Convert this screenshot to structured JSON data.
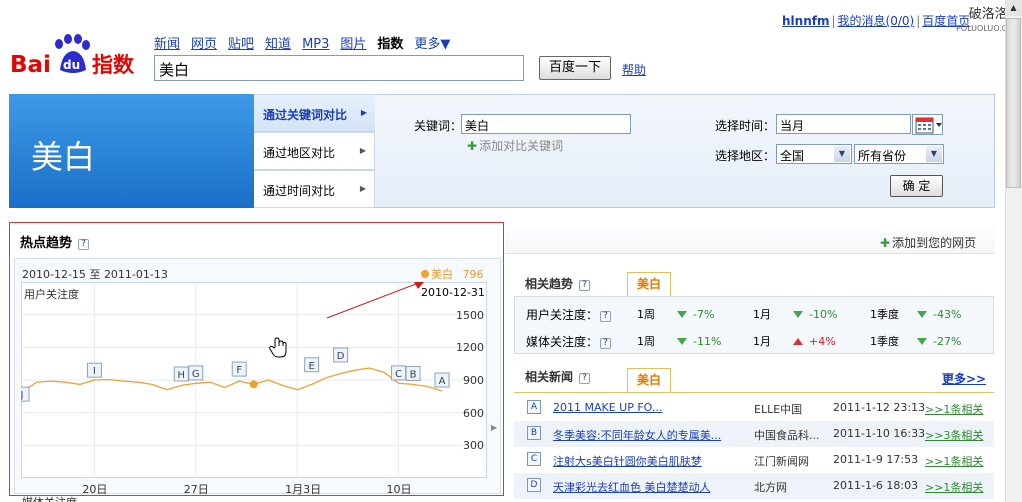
{
  "top_bar": {
    "username": "hlnnfm",
    "messages": "我的消息(0/0)",
    "baidu_home": "百度首页",
    "watermark": "破洛洛",
    "watermark_sub": "POLUOLUO.COM"
  },
  "logo": {
    "text_left": "Bai",
    "text_du": "du",
    "text_right": "指数",
    "brand_red": "#e10602",
    "brand_blue": "#2d2dcf"
  },
  "nav": {
    "items": [
      "新闻",
      "网页",
      "贴吧",
      "知道",
      "MP3",
      "图片"
    ],
    "current": "指数",
    "more": "更多▼"
  },
  "search": {
    "value": "美白",
    "button": "百度一下",
    "help": "帮助"
  },
  "query": {
    "keyword_display": "美白",
    "modes": [
      "通过关键词对比",
      "通过地区对比",
      "通过时间对比"
    ],
    "keyword_label": "关键词：",
    "keyword_value": "美白",
    "add_keyword": "添加对比关键词",
    "time_label": "选择时间：",
    "time_value": "当月",
    "region_label": "选择地区：",
    "region_value": "全国",
    "province_value": "所有省份",
    "confirm": "确  定"
  },
  "hot_trend": {
    "title": "热点趋势",
    "date_from": "2010-12-15",
    "date_sep": "至",
    "date_to": "2011-01-13",
    "legend_name": "美白",
    "legend_value": "796",
    "callout_date": "2010-12-31",
    "bottom_label": "媒体关注度"
  },
  "chart_data": {
    "type": "line",
    "ylabel": "用户关注度",
    "yticks": [
      1500,
      1200,
      900,
      600,
      300
    ],
    "ylim": [
      0,
      1800
    ],
    "xticks": [
      {
        "label": "20日",
        "index": 5
      },
      {
        "label": "27日",
        "index": 12
      },
      {
        "label": "1月3日",
        "index": 19
      },
      {
        "label": "10日",
        "index": 26
      }
    ],
    "values": [
      790,
      880,
      890,
      880,
      860,
      900,
      905,
      890,
      880,
      860,
      810,
      850,
      870,
      880,
      830,
      890,
      860,
      900,
      850,
      810,
      860,
      920,
      960,
      990,
      1010,
      970,
      870,
      860,
      840,
      800
    ],
    "highlight_index": 16,
    "line_color": "#f0a030",
    "markers": [
      {
        "label": "J",
        "index": 0,
        "value": 770
      },
      {
        "label": "I",
        "index": 5,
        "value": 990
      },
      {
        "label": "H",
        "index": 11,
        "value": 955
      },
      {
        "label": "G",
        "index": 12,
        "value": 965
      },
      {
        "label": "F",
        "index": 15,
        "value": 1000
      },
      {
        "label": "E",
        "index": 20,
        "value": 1040
      },
      {
        "label": "D",
        "index": 22,
        "value": 1130
      },
      {
        "label": "C",
        "index": 26,
        "value": 965
      },
      {
        "label": "B",
        "index": 27,
        "value": 960
      },
      {
        "label": "A",
        "index": 29,
        "value": 900
      }
    ]
  },
  "right": {
    "add_to_page": "添加到您的网页",
    "related_trend_title": "相关趋势",
    "tab_keyword": "美白",
    "rows": [
      {
        "label": "用户关注度：",
        "cells": [
          {
            "period": "1周",
            "dir": "down",
            "value": "-7%"
          },
          {
            "period": "1月",
            "dir": "down",
            "value": "-10%"
          },
          {
            "period": "1季度",
            "dir": "down",
            "value": "-43%"
          }
        ]
      },
      {
        "label": "媒体关注度：",
        "cells": [
          {
            "period": "1周",
            "dir": "down",
            "value": "-11%"
          },
          {
            "period": "1月",
            "dir": "up",
            "value": "+4%"
          },
          {
            "period": "1季度",
            "dir": "down",
            "value": "-27%"
          }
        ]
      }
    ],
    "news_title": "相关新闻",
    "news_tab": "美白",
    "more": "更多>>",
    "news": [
      {
        "badge": "A",
        "title": "2011 MAKE UP FO...",
        "source": "ELLE中国",
        "time": "2011-1-12 23:13",
        "related": ">>1条相关"
      },
      {
        "badge": "B",
        "title": "冬季美容:不同年龄女人的专属美...",
        "source": "中国食品科...",
        "time": "2011-1-10 16:33",
        "related": ">>3条相关"
      },
      {
        "badge": "C",
        "title": "注射大s美白针圆你美白肌肤梦",
        "source": "江门新闻网",
        "time": "2011-1-9 17:53",
        "related": ">>1条相关"
      },
      {
        "badge": "D",
        "title": "天津彩光去红血色 美白楚楚动人",
        "source": "北方网",
        "time": "2011-1-6 18:03",
        "related": ">>1条相关"
      }
    ]
  }
}
